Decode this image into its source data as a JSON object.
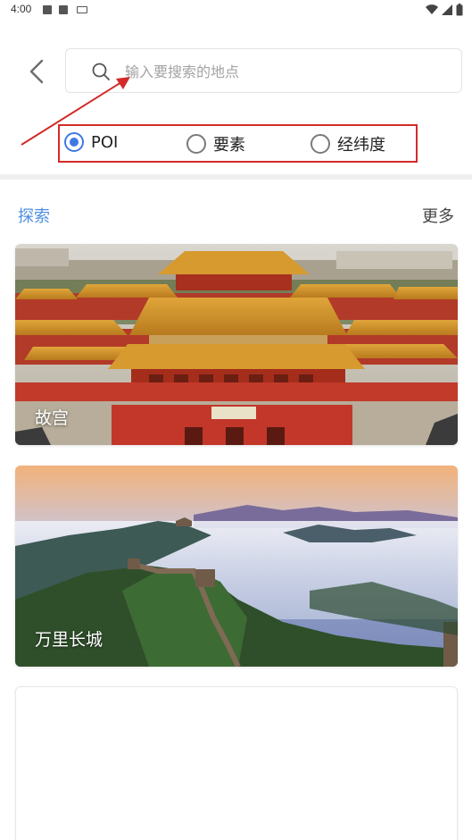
{
  "status_bar": {
    "time": "4:00",
    "icons": [
      "image-icon",
      "a-icon",
      "keyboard-icon",
      "wifi-icon",
      "signal-icon",
      "battery-icon"
    ]
  },
  "header": {
    "back_icon": "chevron-left-icon"
  },
  "search": {
    "placeholder": "输入要搜索的地点",
    "value": ""
  },
  "radio": {
    "options": [
      {
        "label": "POI",
        "checked": true
      },
      {
        "label": "要素",
        "checked": false
      },
      {
        "label": "经纬度",
        "checked": false
      }
    ]
  },
  "explore": {
    "title": "探索",
    "more": "更多"
  },
  "cards": [
    {
      "label": "故宫"
    },
    {
      "label": "万里长城"
    }
  ],
  "colors": {
    "accent": "#3f79e4",
    "explore": "#4e8fe0",
    "annotation": "#d32a2a"
  }
}
